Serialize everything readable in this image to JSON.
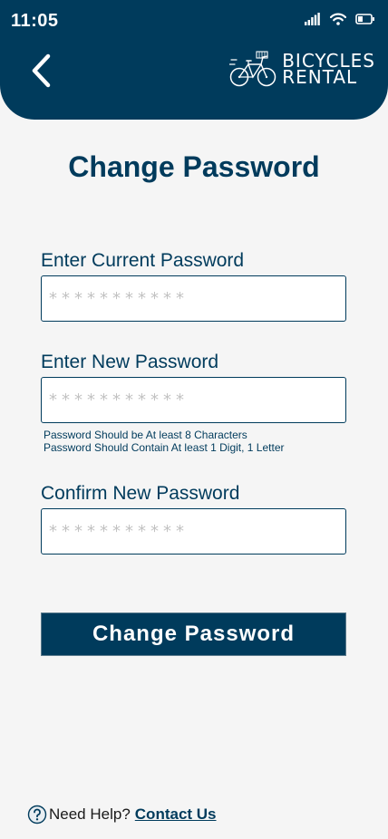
{
  "status_bar": {
    "time": "11:05",
    "icons": [
      "signal-icon",
      "wifi-icon",
      "battery-icon"
    ]
  },
  "header": {
    "back_icon": "chevron-left-icon",
    "brand_line1": "BICYCLES",
    "brand_line2": "RENTAL",
    "brand_icon": "bicycle-icon"
  },
  "page": {
    "title": "Change Password"
  },
  "form": {
    "current": {
      "label": "Enter Current Password",
      "placeholder": "***********"
    },
    "new": {
      "label": "Enter New Password",
      "placeholder": "***********",
      "hint_1": "Password Should be At least 8 Characters",
      "hint_2": "Password Should Contain At least 1 Digit, 1 Letter"
    },
    "confirm": {
      "label": "Confirm New Password",
      "placeholder": "***********"
    },
    "submit_label": "Change Password"
  },
  "footer": {
    "help_icon": "question-icon",
    "help_text": "Need Help?",
    "link_text": "Contact Us"
  },
  "colors": {
    "primary": "#003b5c",
    "background": "#f5f5f5"
  }
}
